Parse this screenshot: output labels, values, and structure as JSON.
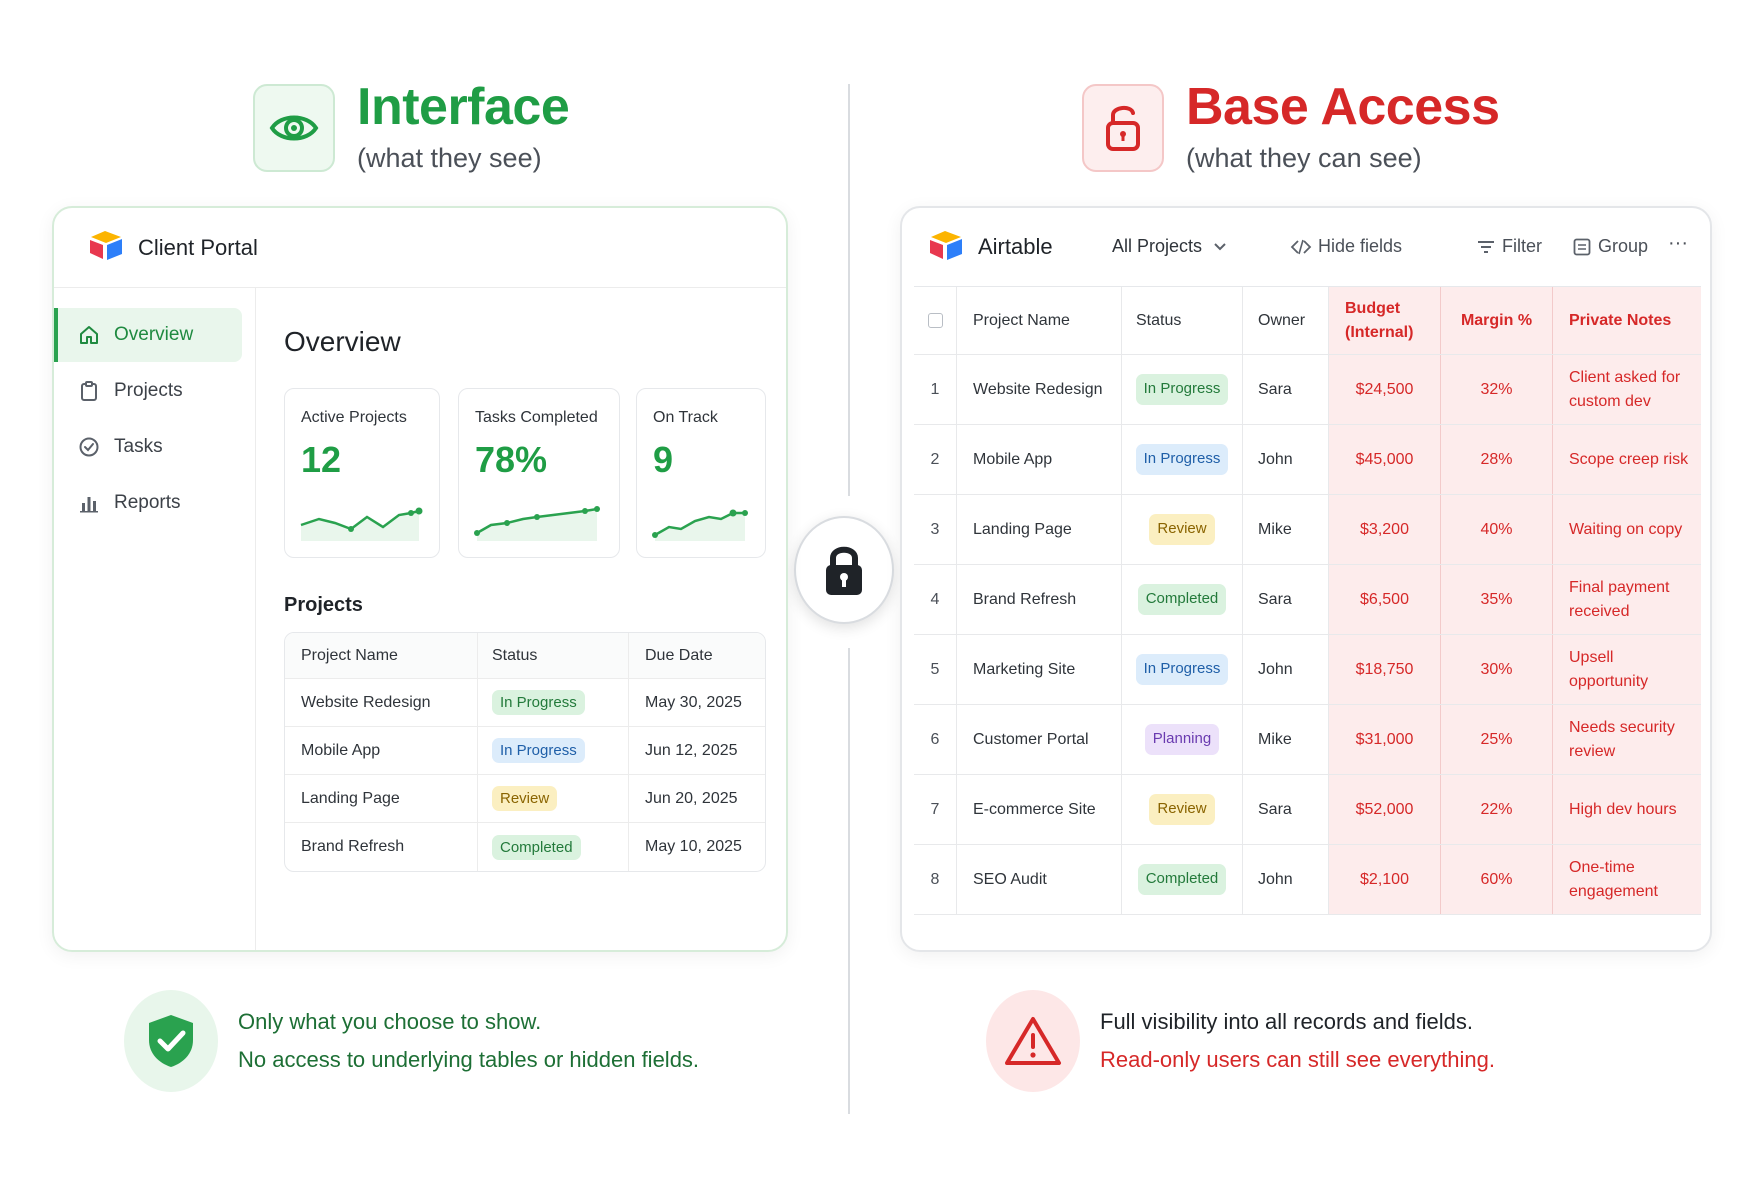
{
  "header_left": {
    "title": "Interface",
    "subtitle": "(what they see)"
  },
  "header_right": {
    "title": "Base Access",
    "subtitle": "(what they can see)"
  },
  "portal": {
    "app_name": "Client Portal",
    "nav": [
      {
        "label": "Overview",
        "active": true
      },
      {
        "label": "Projects"
      },
      {
        "label": "Tasks"
      },
      {
        "label": "Reports"
      }
    ],
    "overview_title": "Overview",
    "kpis": [
      {
        "label": "Active Projects",
        "value": "12"
      },
      {
        "label": "Tasks Completed",
        "value": "78%"
      },
      {
        "label": "On Track",
        "value": "9"
      }
    ],
    "projects_title": "Projects",
    "table": {
      "headers": [
        "Project Name",
        "Status",
        "Due Date"
      ],
      "rows": [
        {
          "name": "Website Redesign",
          "status": "In Progress",
          "due": "May 30, 2025"
        },
        {
          "name": "Mobile App",
          "status": "In Progress",
          "due": "Jun 12, 2025"
        },
        {
          "name": "Landing Page",
          "status": "Review",
          "due": "Jun 20, 2025"
        },
        {
          "name": "Brand Refresh",
          "status": "Completed",
          "due": "May 10, 2025"
        }
      ]
    }
  },
  "base": {
    "app_name": "Airtable",
    "toolbar": {
      "view": "All Projects",
      "hide_fields": "Hide fields",
      "filter": "Filter",
      "group": "Group",
      "more": "···"
    },
    "headers": [
      "Project Name",
      "Status",
      "Owner",
      "Budget (Internal)",
      "Margin %",
      "Private Notes"
    ],
    "rows": [
      {
        "n": "1",
        "name": "Website Redesign",
        "status": "In Progress",
        "owner": "Sara",
        "budget": "$24,500",
        "margin": "32%",
        "notes": "Client asked for custom dev"
      },
      {
        "n": "2",
        "name": "Mobile App",
        "status": "In Progress",
        "owner": "John",
        "budget": "$45,000",
        "margin": "28%",
        "notes": "Scope creep risk"
      },
      {
        "n": "3",
        "name": "Landing Page",
        "status": "Review",
        "owner": "Mike",
        "budget": "$3,200",
        "margin": "40%",
        "notes": "Waiting on copy"
      },
      {
        "n": "4",
        "name": "Brand Refresh",
        "status": "Completed",
        "owner": "Sara",
        "budget": "$6,500",
        "margin": "35%",
        "notes": "Final payment received"
      },
      {
        "n": "5",
        "name": "Marketing Site",
        "status": "In Progress",
        "owner": "John",
        "budget": "$18,750",
        "margin": "30%",
        "notes": "Upsell opportunity"
      },
      {
        "n": "6",
        "name": "Customer Portal",
        "status": "Planning",
        "owner": "Mike",
        "budget": "$31,000",
        "margin": "25%",
        "notes": "Needs security review"
      },
      {
        "n": "7",
        "name": "E-commerce Site",
        "status": "Review",
        "owner": "Sara",
        "budget": "$52,000",
        "margin": "22%",
        "notes": "High dev hours"
      },
      {
        "n": "8",
        "name": "SEO Audit",
        "status": "Completed",
        "owner": "John",
        "budget": "$2,100",
        "margin": "60%",
        "notes": "One-time engagement"
      }
    ]
  },
  "note_left": {
    "line1": "Only what you choose to show.",
    "line2": "No access to underlying tables or hidden fields."
  },
  "note_right": {
    "line1": "Full visibility into all records and fields.",
    "line2": "Read-only users can still see everything."
  },
  "colors": {
    "green_accent": "#1f9d45",
    "red_accent": "#d62828",
    "status": {
      "In Progress": "#dcecfb",
      "Review": "#fbefc1",
      "Completed": "#daf2df",
      "Planning": "#ece1fa"
    }
  },
  "icons": {
    "header_left": "eye-icon",
    "header_right": "unlocked-padlock-icon",
    "center": "padlock-icon",
    "note_left": "shield-check-icon",
    "note_right": "warning-triangle-icon"
  }
}
